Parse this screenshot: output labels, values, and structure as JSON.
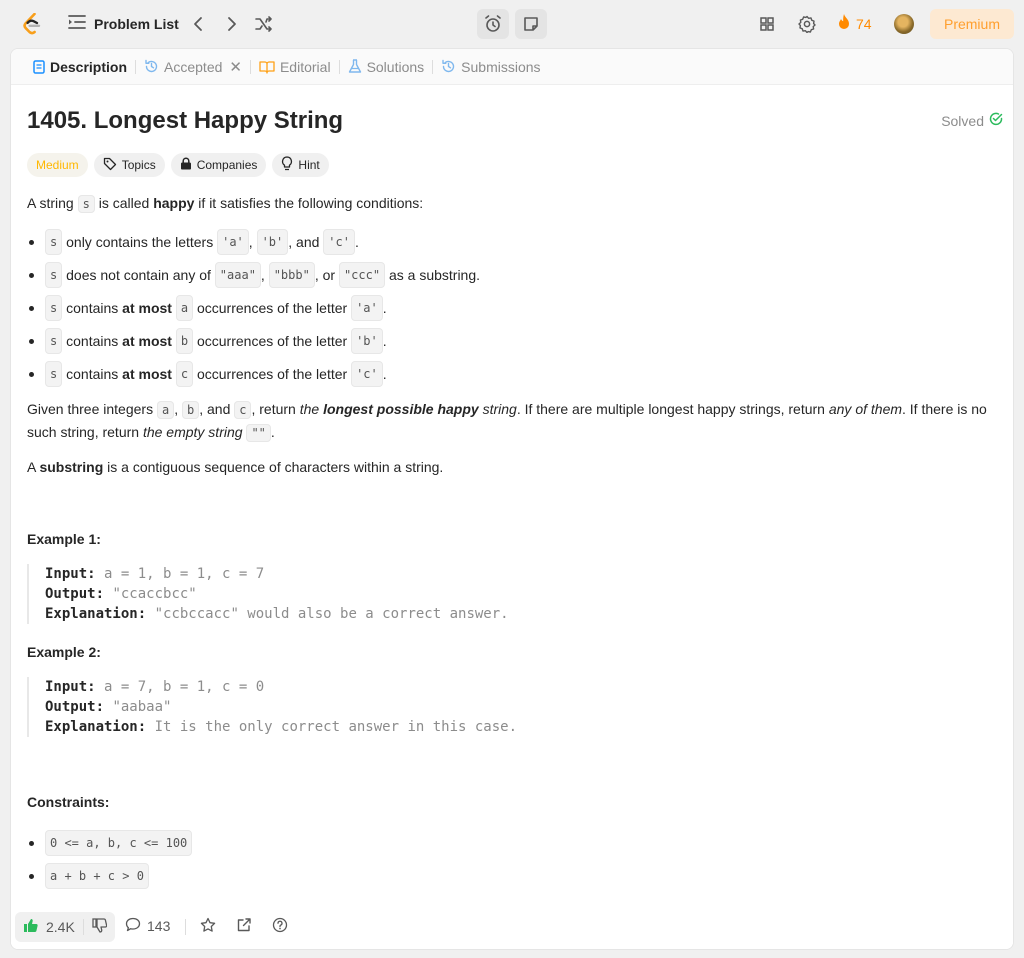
{
  "topbar": {
    "problem_list_label": "Problem List",
    "streak_count": "74",
    "premium_label": "Premium"
  },
  "tabs": [
    {
      "label": "Description"
    },
    {
      "label": "Accepted"
    },
    {
      "label": "Editorial"
    },
    {
      "label": "Solutions"
    },
    {
      "label": "Submissions"
    }
  ],
  "problem": {
    "title": "1405. Longest Happy String",
    "status": "Solved",
    "tags": {
      "difficulty": "Medium",
      "topics": "Topics",
      "companies": "Companies",
      "hint": "Hint"
    }
  },
  "description": {
    "intro": {
      "a": "A string ",
      "s": "s",
      "b": " is called ",
      "bold": "happy",
      "c": " if it satisfies the following conditions:"
    },
    "bullets": {
      "b1": {
        "s": "s",
        "a": " only contains the letters ",
        "l1": "'a'",
        "c1": ", ",
        "l2": "'b'",
        "c2": ", and ",
        "l3": "'c'",
        "end": "."
      },
      "b2": {
        "s": "s",
        "a": " does not contain any of ",
        "l1": "\"aaa\"",
        "c1": ", ",
        "l2": "\"bbb\"",
        "c2": ", or ",
        "l3": "\"ccc\"",
        "end": " as a substring."
      },
      "b3": {
        "s": "s",
        "a": " contains ",
        "bold": "at most",
        "v": "a",
        "b": " occurrences of the letter ",
        "l": "'a'",
        "end": "."
      },
      "b4": {
        "s": "s",
        "a": " contains ",
        "bold": "at most",
        "v": "b",
        "b": " occurrences of the letter ",
        "l": "'b'",
        "end": "."
      },
      "b5": {
        "s": "s",
        "a": " contains ",
        "bold": "at most",
        "v": "c",
        "b": " occurrences of the letter ",
        "l": "'c'",
        "end": "."
      }
    },
    "given": {
      "a": "Given three integers ",
      "va": "a",
      "c1": ", ",
      "vb": "b",
      "c2": ", and ",
      "vc": "c",
      "b": ", return ",
      "i1": "the ",
      "bi": "longest possible happy",
      "i2": " string",
      "c": ". If there are multiple longest happy strings, return ",
      "i3": "any of them",
      "d": ". If there is no such string, return ",
      "i4": "the empty string",
      "e": " ",
      "empty": "\"\"",
      "end": "."
    },
    "substring": {
      "a": "A ",
      "bold": "substring",
      "b": " is a contiguous sequence of characters within a string."
    }
  },
  "examples": [
    {
      "heading": "Example 1:",
      "input_label": "Input:",
      "input": " a = 1, b = 1, c = 7",
      "output_label": "Output:",
      "output": " \"ccaccbcc\"",
      "explanation_label": "Explanation:",
      "explanation": " \"ccbccacc\" would also be a correct answer."
    },
    {
      "heading": "Example 2:",
      "input_label": "Input:",
      "input": " a = 7, b = 1, c = 0",
      "output_label": "Output:",
      "output": " \"aabaa\"",
      "explanation_label": "Explanation:",
      "explanation": " It is the only correct answer in this case."
    }
  ],
  "constraints": {
    "heading": "Constraints:",
    "items": [
      "0 <= a, b, c <= 100",
      "a + b + c > 0"
    ]
  },
  "bottombar": {
    "likes": "2.4K",
    "comments": "143"
  },
  "colors": {
    "accent_orange": "#ff8a00",
    "medium": "#ffb800",
    "solved_green": "#2cbb5d",
    "like_green": "#2cbb5d"
  }
}
